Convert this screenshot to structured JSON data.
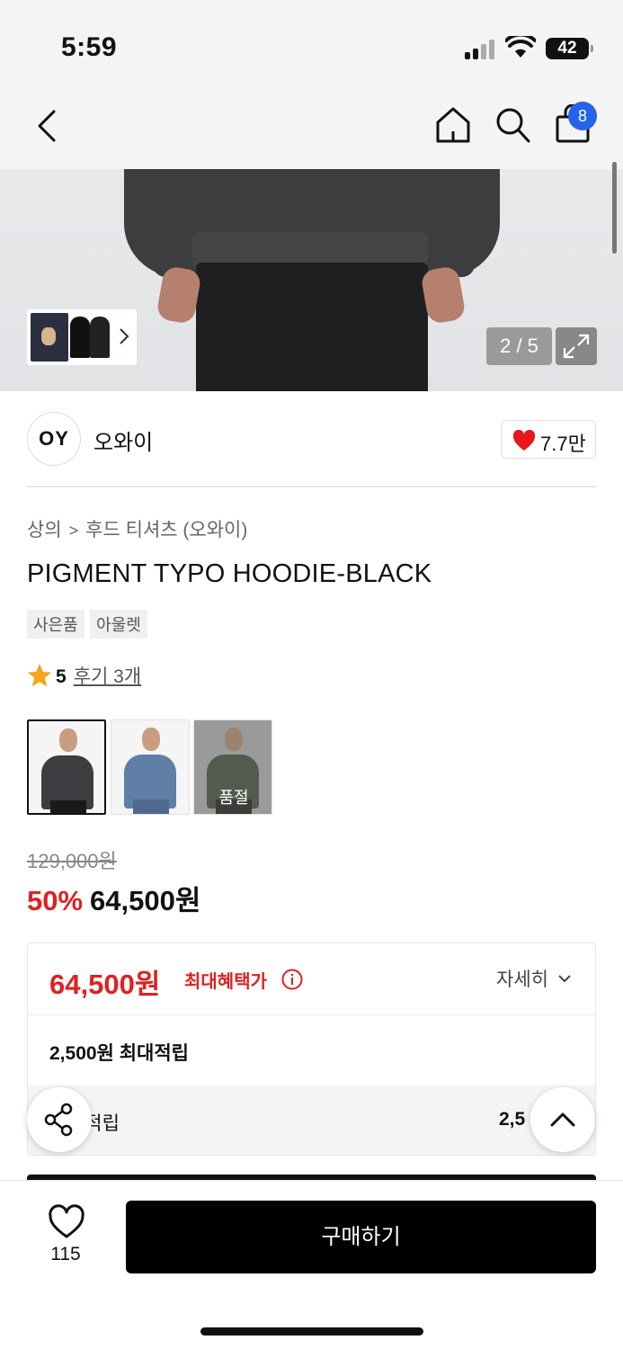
{
  "status_bar": {
    "time": "5:59",
    "battery": "42"
  },
  "nav": {
    "cart_count": "8"
  },
  "gallery": {
    "counter": "2 / 5"
  },
  "brand": {
    "logo_text": "OY",
    "name": "오와이",
    "likes": "7.7만"
  },
  "breadcrumb": {
    "category": "상의",
    "separator": ">",
    "subcategory": "후드 티셔츠 (오와이)"
  },
  "product": {
    "title": "PIGMENT TYPO HOODIE-BLACK",
    "tags": [
      "사은품",
      "아울렛"
    ],
    "rating": "5",
    "reviews": "후기 3개",
    "variants": [
      {
        "color": "black",
        "selected": true,
        "sold_out_label": ""
      },
      {
        "color": "blue",
        "selected": false,
        "sold_out_label": ""
      },
      {
        "color": "khaki",
        "selected": false,
        "sold_out_label": "품절"
      }
    ],
    "original_price": "129,000원",
    "discount": "50%",
    "sale_price": "64,500원"
  },
  "benefits": {
    "max_price": "64,500원",
    "max_label": "최대혜택가",
    "detail_label": "자세히",
    "max_points": "2,500원 최대적립",
    "accrual_label": "| 적립",
    "accrual_value": "2,5"
  },
  "bottom": {
    "wish_count": "115",
    "buy_label": "구매하기"
  },
  "colors": {
    "accent_red": "#e02020",
    "badge_blue": "#2563eb",
    "buy_button": "#000000"
  }
}
